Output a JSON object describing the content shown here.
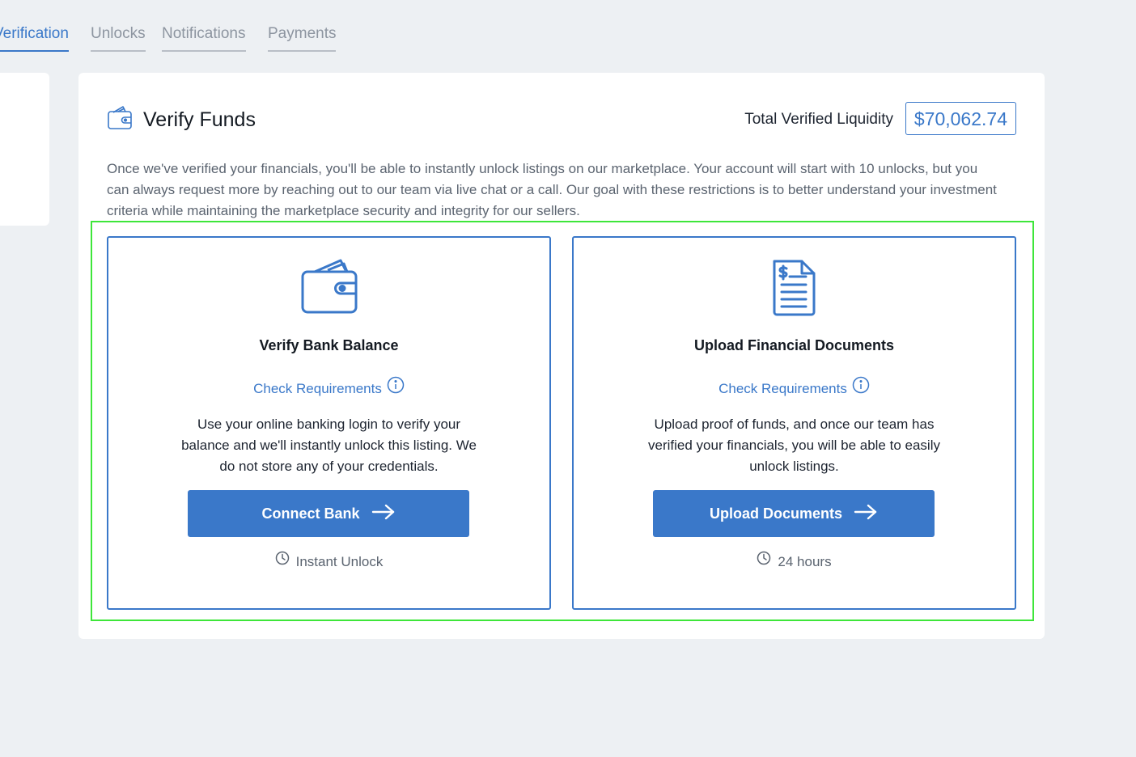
{
  "tabs": [
    {
      "label": "Verification",
      "active": true
    },
    {
      "label": "Unlocks",
      "active": false
    },
    {
      "label": "Notifications",
      "active": false
    },
    {
      "label": "Payments",
      "active": false
    }
  ],
  "header": {
    "title": "Verify Funds",
    "title_icon": "wallet-icon",
    "liquidity_label": "Total Verified Liquidity",
    "liquidity_value": "$70,062.74"
  },
  "description": "Once we've verified your financials, you'll be able to instantly unlock listings on our marketplace. Your account will start with 10 unlocks, but you can always request more by reaching out to our team via live chat or a call. Our goal with these restrictions is to better understand your investment criteria while maintaining the marketplace security and integrity for our sellers.",
  "options": [
    {
      "icon": "wallet-icon",
      "title": "Verify Bank Balance",
      "requirements_label": "Check Requirements",
      "description": "Use your online banking login to verify your balance and we'll instantly unlock this listing. We do not store any of your credentials.",
      "button_label": "Connect Bank",
      "time_label": "Instant Unlock"
    },
    {
      "icon": "document-dollar-icon",
      "title": "Upload Financial Documents",
      "requirements_label": "Check Requirements",
      "description": "Upload proof of funds, and once our team has verified your financials, you will be able to easily unlock listings.",
      "button_label": "Upload Documents",
      "time_label": "24 hours"
    }
  ],
  "colors": {
    "accent": "#3a78c9",
    "background": "#edf0f3",
    "highlight": "#3ee63a"
  }
}
